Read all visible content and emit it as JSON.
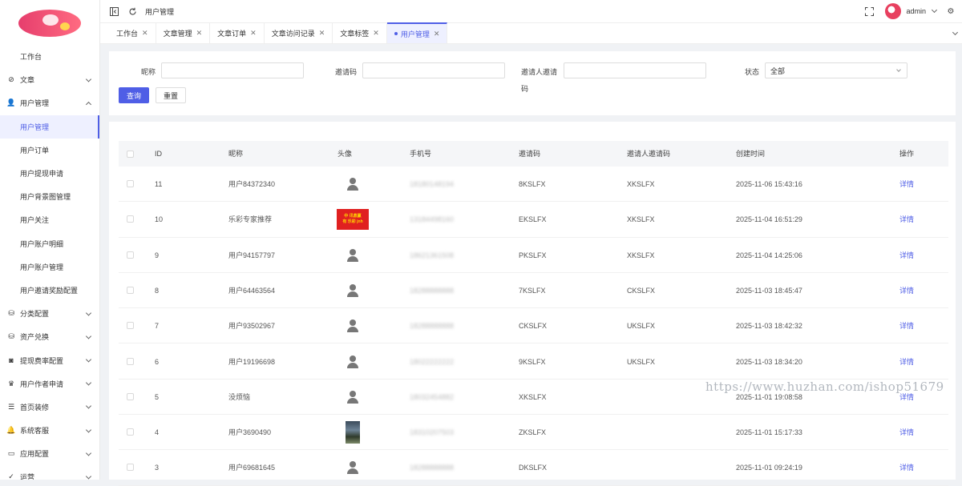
{
  "sidebar": {
    "items": [
      {
        "label": "工作台",
        "icon": "none",
        "type": "plain"
      },
      {
        "label": "文章",
        "icon": "compass-icon",
        "type": "group",
        "expanded": false
      },
      {
        "label": "用户管理",
        "icon": "user-icon",
        "type": "group",
        "expanded": true
      },
      {
        "label": "用户管理",
        "type": "sub",
        "active": true
      },
      {
        "label": "用户订单",
        "type": "sub"
      },
      {
        "label": "用户提现申请",
        "type": "sub"
      },
      {
        "label": "用户背景图管理",
        "type": "sub"
      },
      {
        "label": "用户关注",
        "type": "sub"
      },
      {
        "label": "用户账户明细",
        "type": "sub"
      },
      {
        "label": "用户账户管理",
        "type": "sub"
      },
      {
        "label": "用户邀请奖励配置",
        "type": "sub"
      },
      {
        "label": "分类配置",
        "icon": "database-icon",
        "type": "group"
      },
      {
        "label": "资产兑换",
        "icon": "database-icon",
        "type": "group"
      },
      {
        "label": "提现费率配置",
        "icon": "camera-icon",
        "type": "group"
      },
      {
        "label": "用户作者申请",
        "icon": "trophy-icon",
        "type": "group"
      },
      {
        "label": "首页装修",
        "icon": "list-icon",
        "type": "group"
      },
      {
        "label": "系统客服",
        "icon": "bell-icon",
        "type": "group"
      },
      {
        "label": "应用配置",
        "icon": "card-icon",
        "type": "group"
      },
      {
        "label": "运营",
        "icon": "check-icon",
        "type": "group"
      }
    ]
  },
  "topbar": {
    "title": "用户管理",
    "user": "admin"
  },
  "tabs": [
    {
      "label": "工作台",
      "active": false
    },
    {
      "label": "文章管理",
      "active": false
    },
    {
      "label": "文章订单",
      "active": false
    },
    {
      "label": "文章访问记录",
      "active": false
    },
    {
      "label": "文章标签",
      "active": false
    },
    {
      "label": "用户管理",
      "active": true
    }
  ],
  "filter": {
    "nickname_label": "昵称",
    "nickname_value": "",
    "invite_label": "邀请码",
    "invite_value": "",
    "inviter_label_line1": "邀请人邀请",
    "inviter_label_line2": "码",
    "inviter_value": "",
    "status_label": "状态",
    "status_value": "全部",
    "search_button": "查询",
    "reset_button": "重置"
  },
  "table": {
    "columns": [
      "ID",
      "昵称",
      "头像",
      "手机号",
      "邀请码",
      "邀请人邀请码",
      "创建时间",
      "操作"
    ],
    "rows": [
      {
        "id": "11",
        "nickname": "用户84372340",
        "avatar": "default",
        "phone": "18180148194",
        "invite": "8KSLFX",
        "inviter": "XKSLFX",
        "created": "2025-11-06 15:43:16",
        "action": "详情"
      },
      {
        "id": "10",
        "nickname": "乐彩专家推荐",
        "avatar": "red-banner",
        "phone": "13184498160",
        "invite": "EKSLFX",
        "inviter": "XKSLFX",
        "created": "2025-11-04 16:51:29",
        "action": "详情"
      },
      {
        "id": "9",
        "nickname": "用户94157797",
        "avatar": "default",
        "phone": "18621361508",
        "invite": "PKSLFX",
        "inviter": "XKSLFX",
        "created": "2025-11-04 14:25:06",
        "action": "详情"
      },
      {
        "id": "8",
        "nickname": "用户64463564",
        "avatar": "default",
        "phone": "18288888888",
        "invite": "7KSLFX",
        "inviter": "CKSLFX",
        "created": "2025-11-03 18:45:47",
        "action": "详情"
      },
      {
        "id": "7",
        "nickname": "用户93502967",
        "avatar": "default",
        "phone": "18288888888",
        "invite": "CKSLFX",
        "inviter": "UKSLFX",
        "created": "2025-11-03 18:42:32",
        "action": "详情"
      },
      {
        "id": "6",
        "nickname": "用户19196698",
        "avatar": "default",
        "phone": "18022222222",
        "invite": "9KSLFX",
        "inviter": "UKSLFX",
        "created": "2025-11-03 18:34:20",
        "action": "详情"
      },
      {
        "id": "5",
        "nickname": "没烦恼",
        "avatar": "default",
        "phone": "18032454882",
        "invite": "XKSLFX",
        "inviter": "",
        "created": "2025-11-01 19:08:58",
        "action": "详情"
      },
      {
        "id": "4",
        "nickname": "用户3690490",
        "avatar": "photo",
        "phone": "18310207503",
        "invite": "ZKSLFX",
        "inviter": "",
        "created": "2025-11-01 15:17:33",
        "action": "详情"
      },
      {
        "id": "3",
        "nickname": "用户69681645",
        "avatar": "default",
        "phone": "18288888888",
        "invite": "DKSLFX",
        "inviter": "",
        "created": "2025-11-01 09:24:19",
        "action": "详情"
      }
    ],
    "red_banner_text_line1": "中 讯鼎赢",
    "red_banner_text_line2": "有 乐彩 jnh"
  },
  "watermark": "https://www.huzhan.com/ishop51679",
  "colors": {
    "accent": "#4f5ee6",
    "brand": "#e63e6d"
  }
}
